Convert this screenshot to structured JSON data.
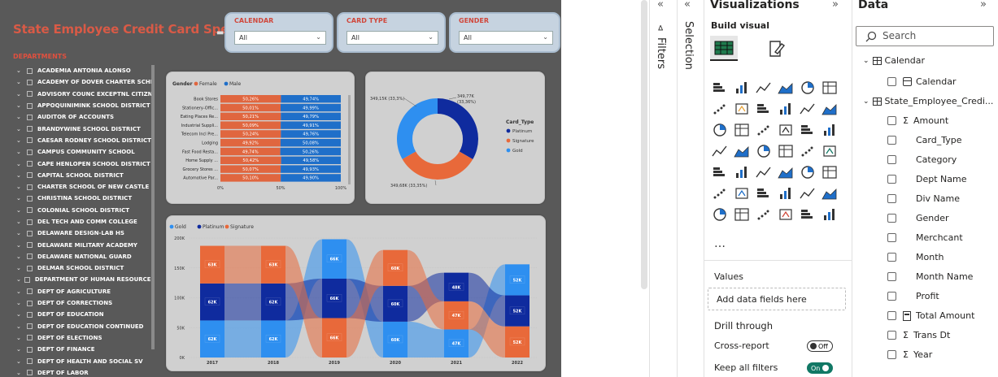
{
  "report": {
    "title": "State Employee Credit Card Spend",
    "slicers": [
      {
        "label": "CALENDAR",
        "value": "All"
      },
      {
        "label": "CARD TYPE",
        "value": "All"
      },
      {
        "label": "GENDER",
        "value": "All"
      }
    ],
    "departments_title": "DEPARTMENTS",
    "departments": [
      "ACADEMIA ANTONIA ALONSO",
      "ACADEMY OF DOVER CHARTER SCHL",
      "ADVISORY COUNC EXCEPTNL CITIZN",
      "APPOQUINIMINK SCHOOL DISTRICT",
      "AUDITOR OF ACCOUNTS",
      "BRANDYWINE SCHOOL DISTRICT",
      "CAESAR RODNEY SCHOOL DISTRICT",
      "CAMPUS COMMUNITY SCHOOL",
      "CAPE HENLOPEN SCHOOL DISTRICT",
      "CAPITAL SCHOOL DISTRICT",
      "CHARTER SCHOOL OF NEW CASTLE",
      "CHRISTINA SCHOOL DISTRICT",
      "COLONIAL SCHOOL DISTRICT",
      "DEL TECH AND COMM COLLEGE",
      "DELAWARE DESIGN-LAB HS",
      "DELAWARE MILITARY ACADEMY",
      "DELAWARE NATIONAL GUARD",
      "DELMAR SCHOOL DISTRICT",
      "DEPARTMENT OF HUMAN RESOURCES",
      "DEPT OF AGRICULTURE",
      "DEPT OF CORRECTIONS",
      "DEPT OF EDUCATION",
      "DEPT OF EDUCATION CONTINUED",
      "DEPT OF ELECTIONS",
      "DEPT OF FINANCE",
      "DEPT OF HEALTH AND SOCIAL SV",
      "DEPT OF LABOR"
    ]
  },
  "colors": {
    "female": "#e0663f",
    "male": "#1f6fc9",
    "platinum": "#0f2b9e",
    "signature": "#e8693a",
    "gold": "#2e8ff0"
  },
  "chart_data": [
    {
      "type": "bar",
      "title": "Gender",
      "legend": [
        "Female",
        "Male"
      ],
      "categories": [
        "Book Stores",
        "Stationery-Offic...",
        "Eating Places Re...",
        "Industrial Suppli...",
        "Telecom Incl Pre...",
        "Lodging",
        "Fast Food Resta...",
        "Home Supply ...",
        "Grocery Stores ...",
        "Automotive Par..."
      ],
      "series": [
        {
          "name": "Female",
          "values": [
            50.26,
            50.01,
            50.21,
            50.09,
            50.24,
            49.92,
            49.74,
            50.42,
            50.07,
            50.1
          ],
          "labels": [
            "50,26%",
            "50,01%",
            "50,21%",
            "50,09%",
            "50,24%",
            "49,92%",
            "49,74%",
            "50,42%",
            "50,07%",
            "50,10%"
          ]
        },
        {
          "name": "Male",
          "values": [
            49.74,
            49.99,
            49.79,
            49.91,
            49.76,
            50.08,
            50.26,
            49.58,
            49.93,
            49.9
          ],
          "labels": [
            "49,74%",
            "49,99%",
            "49,79%",
            "49,91%",
            "49,76%",
            "50,08%",
            "50,26%",
            "49,58%",
            "49,93%",
            "49,90%"
          ]
        }
      ],
      "xticks": [
        "0%",
        "50%",
        "100%"
      ],
      "stacked": true,
      "orientation": "horizontal",
      "legend_position": "top-left"
    },
    {
      "type": "pie",
      "donut": true,
      "legend_title": "Card_Type",
      "legend": [
        "Platinum",
        "Signature",
        "Gold"
      ],
      "values": [
        349.77,
        349.68,
        349.15
      ],
      "labels": [
        "349,77K (33,36%)",
        "349,68K (33,35%)",
        "349,15K (33,3%)"
      ],
      "legend_position": "right"
    },
    {
      "type": "area",
      "subtype": "ribbon",
      "legend": [
        "Gold",
        "Platinum",
        "Signature"
      ],
      "categories": [
        "2017",
        "2018",
        "2019",
        "2020",
        "2021",
        "2022"
      ],
      "yticks": [
        "0K",
        "50K",
        "100K",
        "150K",
        "200K"
      ],
      "ylim": [
        0,
        200
      ],
      "stack_order_bottom_to_top": [
        [
          "Gold",
          "Platinum",
          "Signature"
        ],
        [
          "Gold",
          "Platinum",
          "Signature"
        ],
        [
          "Signature",
          "Platinum",
          "Gold"
        ],
        [
          "Gold",
          "Platinum",
          "Signature"
        ],
        [
          "Gold",
          "Signature",
          "Platinum"
        ],
        [
          "Signature",
          "Platinum",
          "Gold"
        ]
      ],
      "series": [
        {
          "name": "Gold",
          "values": [
            62,
            62,
            66,
            60,
            47,
            52
          ],
          "labels": [
            "62K",
            "62K",
            "66K",
            "60K",
            "47K",
            "52K"
          ]
        },
        {
          "name": "Platinum",
          "values": [
            62,
            62,
            66,
            60,
            48,
            52
          ],
          "labels": [
            "62K",
            "62K",
            "66K",
            "60K",
            "48K",
            "52K"
          ]
        },
        {
          "name": "Signature",
          "values": [
            63,
            63,
            66,
            60,
            47,
            52
          ],
          "labels": [
            "63K",
            "63K",
            "66K",
            "60K",
            "47K",
            "52K"
          ]
        }
      ],
      "legend_position": "top-left"
    }
  ],
  "side": {
    "filters_label": "Filters",
    "selection_label": "Selection",
    "viz_title": "Visualizations",
    "build_visual": "Build visual",
    "more": "…",
    "values_label": "Values",
    "add_fields": "Add data fields here",
    "drill_through": "Drill through",
    "cross_report": "Cross-report",
    "cross_report_state": "Off",
    "keep_filters": "Keep all filters",
    "keep_filters_state": "On",
    "viz_icons": [
      "stacked-bar-icon",
      "stacked-column-icon",
      "clustered-bar-icon",
      "clustered-column-icon",
      "100-bar-icon",
      "100-column-icon",
      "line-chart-icon",
      "area-chart-icon",
      "stacked-area-icon",
      "100-area-icon",
      "line-column-icon",
      "line-clustered-icon",
      "ribbon-chart-icon",
      "waterfall-icon",
      "funnel-icon",
      "scatter-icon",
      "pie-icon",
      "donut-icon",
      "treemap-icon",
      "map-icon",
      "filled-map-icon",
      "azure-map-icon",
      "gauge-icon",
      "card-icon",
      "multirow-card-icon",
      "kpi-icon",
      "slicer-icon",
      "table-icon",
      "matrix-icon",
      "r-visual-icon",
      "python-visual-icon",
      "key-influencers-icon",
      "decomposition-tree-icon",
      "qa-icon",
      "smart-narrative-icon",
      "metrics-icon",
      "paginated-icon",
      "power-apps-icon",
      "power-automate-icon",
      "arcgis-icon",
      "get-more-icon",
      "forward-icon"
    ],
    "data_title": "Data",
    "search_placeholder": "Search",
    "tree": [
      {
        "label": "Calendar",
        "kind": "table-calendar",
        "indent": 0,
        "expanded": true
      },
      {
        "label": "Calendar",
        "kind": "date-field",
        "indent": 1
      },
      {
        "label": "State_Employee_Credi...",
        "kind": "table",
        "indent": 0,
        "expanded": true
      },
      {
        "label": "Amount",
        "kind": "sigma",
        "indent": 1
      },
      {
        "label": "Card_Type",
        "kind": "text",
        "indent": 1
      },
      {
        "label": "Category",
        "kind": "text",
        "indent": 1
      },
      {
        "label": "Dept Name",
        "kind": "text",
        "indent": 1
      },
      {
        "label": "Div Name",
        "kind": "text",
        "indent": 1
      },
      {
        "label": "Gender",
        "kind": "text",
        "indent": 1
      },
      {
        "label": "Merchcant",
        "kind": "text",
        "indent": 1
      },
      {
        "label": "Month",
        "kind": "text",
        "indent": 1
      },
      {
        "label": "Month Name",
        "kind": "text",
        "indent": 1
      },
      {
        "label": "Profit",
        "kind": "text",
        "indent": 1
      },
      {
        "label": "Total Amount",
        "kind": "calc",
        "indent": 1
      },
      {
        "label": "Trans Dt",
        "kind": "sigma",
        "indent": 1
      },
      {
        "label": "Year",
        "kind": "sigma",
        "indent": 1
      }
    ]
  }
}
